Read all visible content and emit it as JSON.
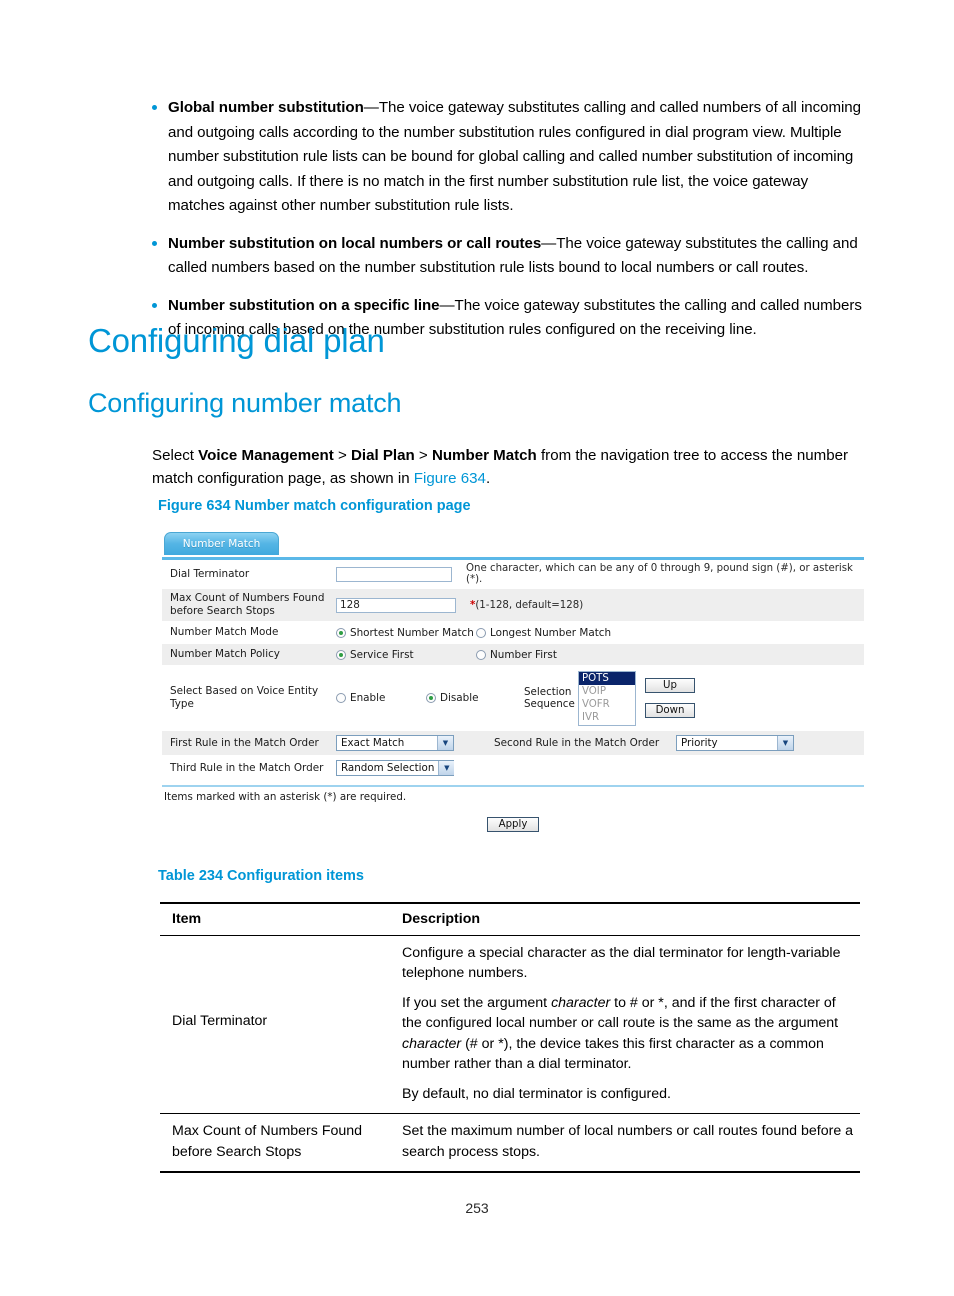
{
  "bullets": [
    {
      "term": "Global number substitution",
      "dash": "—",
      "text": "The voice gateway substitutes calling and called numbers of all incoming and outgoing calls according to the number substitution rules configured in dial program view. Multiple number substitution rule lists can be bound for global calling and called number substitution of incoming and outgoing calls. If there is no match in the first number substitution rule list, the voice gateway matches against other number substitution rule lists."
    },
    {
      "term": "Number substitution on local numbers or call routes",
      "dash": "—",
      "text": "The voice gateway substitutes the calling and called numbers based on the number substitution rule lists bound to local numbers or call routes."
    },
    {
      "term": "Number substitution on a specific line",
      "dash": "—",
      "text": "The voice gateway substitutes the calling and called numbers of incoming calls based on the number substitution rules configured on the receiving line."
    }
  ],
  "headings": {
    "h1": "Configuring dial plan",
    "h2": "Configuring number match"
  },
  "intro": {
    "select_word": "Select ",
    "path1": "Voice Management",
    "sep1": " > ",
    "path2": "Dial Plan",
    "sep2": " > ",
    "path3": "Number Match",
    "tail": " from the navigation tree to access the number match configuration page, as shown in ",
    "figure_link": "Figure 634",
    "period": "."
  },
  "figure_caption": "Figure 634 Number match configuration page",
  "figure": {
    "tab_label": "Number Match",
    "rows": {
      "dial_terminator_label": "Dial Terminator",
      "dial_terminator_value": "",
      "dial_terminator_hint": "One character, which can be any of 0 through 9, pound sign (#), or asterisk (*).",
      "max_count_label": "Max Count of Numbers Found before Search Stops",
      "max_count_value": "128",
      "max_count_required": "*",
      "max_count_hint": "(1-128, default=128)",
      "match_mode_label": "Number Match Mode",
      "match_mode_opt1": "Shortest Number Match",
      "match_mode_opt2": "Longest Number Match",
      "match_policy_label": "Number Match Policy",
      "match_policy_opt1": "Service First",
      "match_policy_opt2": "Number First",
      "entity_label": "Select Based on Voice Entity Type",
      "entity_opt_enable": "Enable",
      "entity_opt_disable": "Disable",
      "sequence_label": "Selection Sequence",
      "sequence_items": [
        "POTS",
        "VOIP",
        "VOFR",
        "IVR"
      ],
      "sequence_selected": "POTS",
      "up_button": "Up",
      "down_button": "Down",
      "first_rule_label": "First Rule in the Match Order",
      "first_rule_value": "Exact Match",
      "second_rule_label": "Second Rule in the Match Order",
      "second_rule_value": "Priority",
      "third_rule_label": "Third Rule in the Match Order",
      "third_rule_value": "Random Selection"
    },
    "note": "Items marked with an asterisk (*) are required.",
    "apply_button": "Apply"
  },
  "table_caption": "Table 234 Configuration items",
  "table": {
    "headers": {
      "item": "Item",
      "description": "Description"
    },
    "rows": [
      {
        "item": "Dial Terminator",
        "paragraphs": [
          "Configure a special character as the dial terminator for length-variable telephone numbers.",
          "If you set the argument character to # or *, and if the first character of the configured local number or call route is the same as the argument character (# or *), the device takes this first character as a common number rather than a dial terminator.",
          "By default, no dial terminator is configured."
        ]
      },
      {
        "item": "Max Count of Numbers Found before Search Stops",
        "paragraphs": [
          "Set the maximum number of local numbers or call routes found before a search process stops."
        ]
      }
    ]
  },
  "page_number": "253",
  "colors": {
    "accent": "#0096d6",
    "tab_blue": "#55b5e5",
    "required_red": "#cc0000",
    "radio_green": "#2f9e44",
    "listbox_select": "#0a246a"
  }
}
